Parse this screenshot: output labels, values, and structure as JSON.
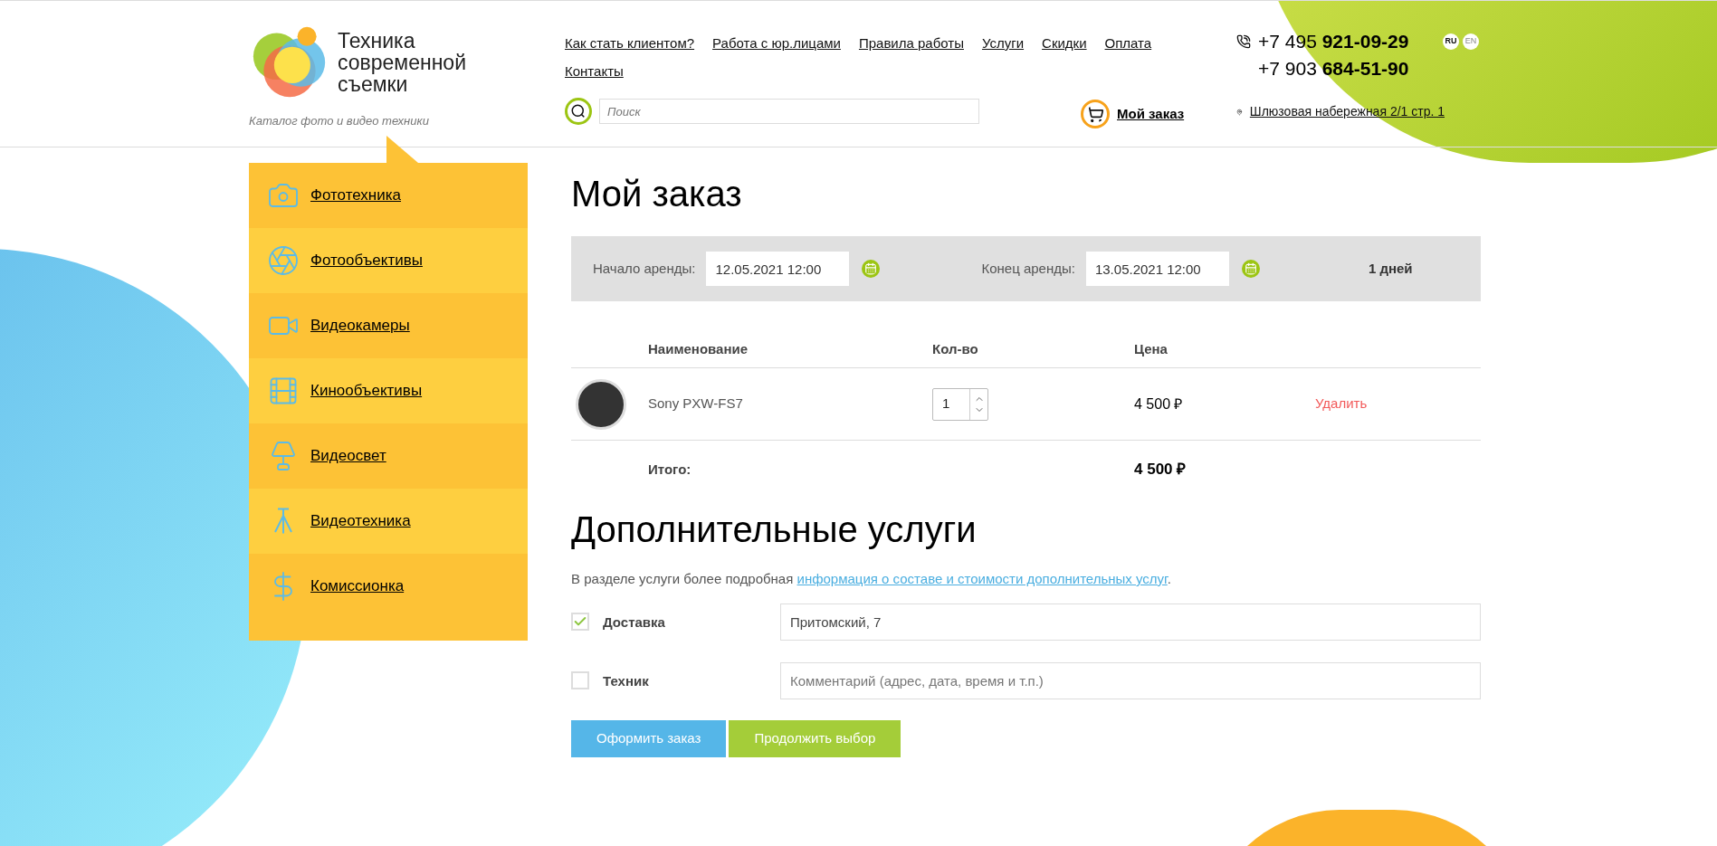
{
  "logo": {
    "title_lines": [
      "Техника",
      "современной",
      "съемки"
    ],
    "tagline": "Каталог фото и видео техники"
  },
  "nav_links": [
    "Как стать клиентом?",
    "Работа с юр.лицами",
    "Правила работы",
    "Услуги",
    "Скидки",
    "Оплата",
    "Контакты"
  ],
  "search": {
    "placeholder": "Поиск"
  },
  "cart_link": "Мой заказ",
  "phones": [
    {
      "prefix": "+7 495",
      "number": "921-09-29"
    },
    {
      "prefix": "+7 903",
      "number": "684-51-90"
    }
  ],
  "languages": [
    {
      "label": "RU",
      "selected": true
    },
    {
      "label": "EN",
      "selected": false
    }
  ],
  "address": "Шлюзовая набережная 2/1 стр. 1",
  "sidebar": {
    "items": [
      {
        "label": "Фототехника",
        "kind": "camera"
      },
      {
        "label": "Фотообъективы",
        "kind": "lens"
      },
      {
        "label": "Видеокамеры",
        "kind": "video"
      },
      {
        "label": "Кинообъективы",
        "kind": "cinelens"
      },
      {
        "label": "Видеосвет",
        "kind": "light"
      },
      {
        "label": "Видеотехника",
        "kind": "tripod"
      },
      {
        "label": "Комиссионка",
        "kind": "dollar"
      }
    ]
  },
  "page_title": "Мой заказ",
  "rental": {
    "start_label": "Начало аренды:",
    "start_value": "12.05.2021 12:00",
    "end_label": "Конец аренды:",
    "end_value": "13.05.2021 12:00",
    "duration": "1 дней"
  },
  "table": {
    "columns": [
      "Наименование",
      "Кол-во",
      "Цена"
    ],
    "rows": [
      {
        "name": "Sony PXW-FS7",
        "quantity": "1",
        "price": "4 500 ₽",
        "action": "Удалить"
      }
    ],
    "total_label": "Итого:",
    "total_value": "4 500 ₽"
  },
  "services": {
    "title": "Дополнительные услуги",
    "intro": "В разделе услуги более подробная ",
    "intro_link": "информация о составе и стоимости дополнительных услуг",
    "intro_end": ".",
    "options": [
      {
        "label": "Доставка",
        "checked": true,
        "value": "Притомский, 7"
      },
      {
        "label": "Техник",
        "checked": false,
        "placeholder": "Комментарий (адрес, дата, время и т.п.)"
      }
    ]
  },
  "buttons": [
    {
      "label": "Оформить заказ",
      "kind": "primary"
    },
    {
      "label": "Продолжить выбор",
      "kind": "secondary"
    }
  ]
}
